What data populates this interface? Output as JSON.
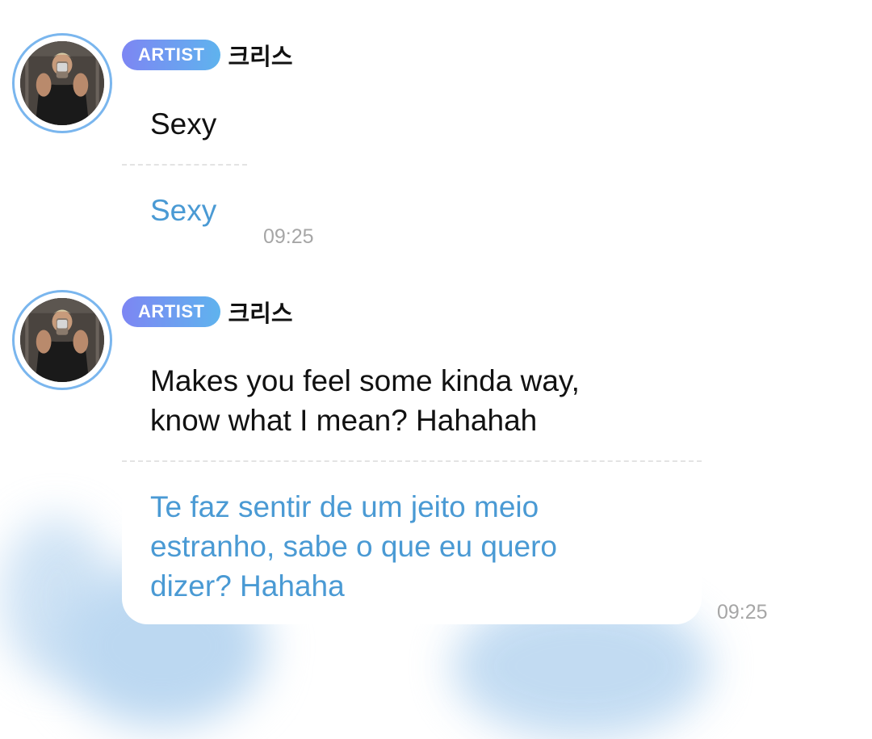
{
  "colors": {
    "badge_gradient_start": "#7d86f3",
    "badge_gradient_end": "#5fb3ee",
    "translation_text": "#4a9ad4",
    "avatar_ring": "#7ab6ee",
    "timestamp": "#a6a6a6"
  },
  "messages": [
    {
      "badge": "ARTIST",
      "sender": "크리스",
      "text": "Sexy",
      "translation": "Sexy",
      "time": "09:25"
    },
    {
      "badge": "ARTIST",
      "sender": "크리스",
      "text_lines": [
        "Makes you feel some kinda way,",
        "know what I mean? Hahahah"
      ],
      "translation_lines": [
        "Te faz sentir de um jeito meio",
        "estranho, sabe o que eu quero",
        "dizer? Hahaha"
      ],
      "time": "09:25"
    }
  ]
}
